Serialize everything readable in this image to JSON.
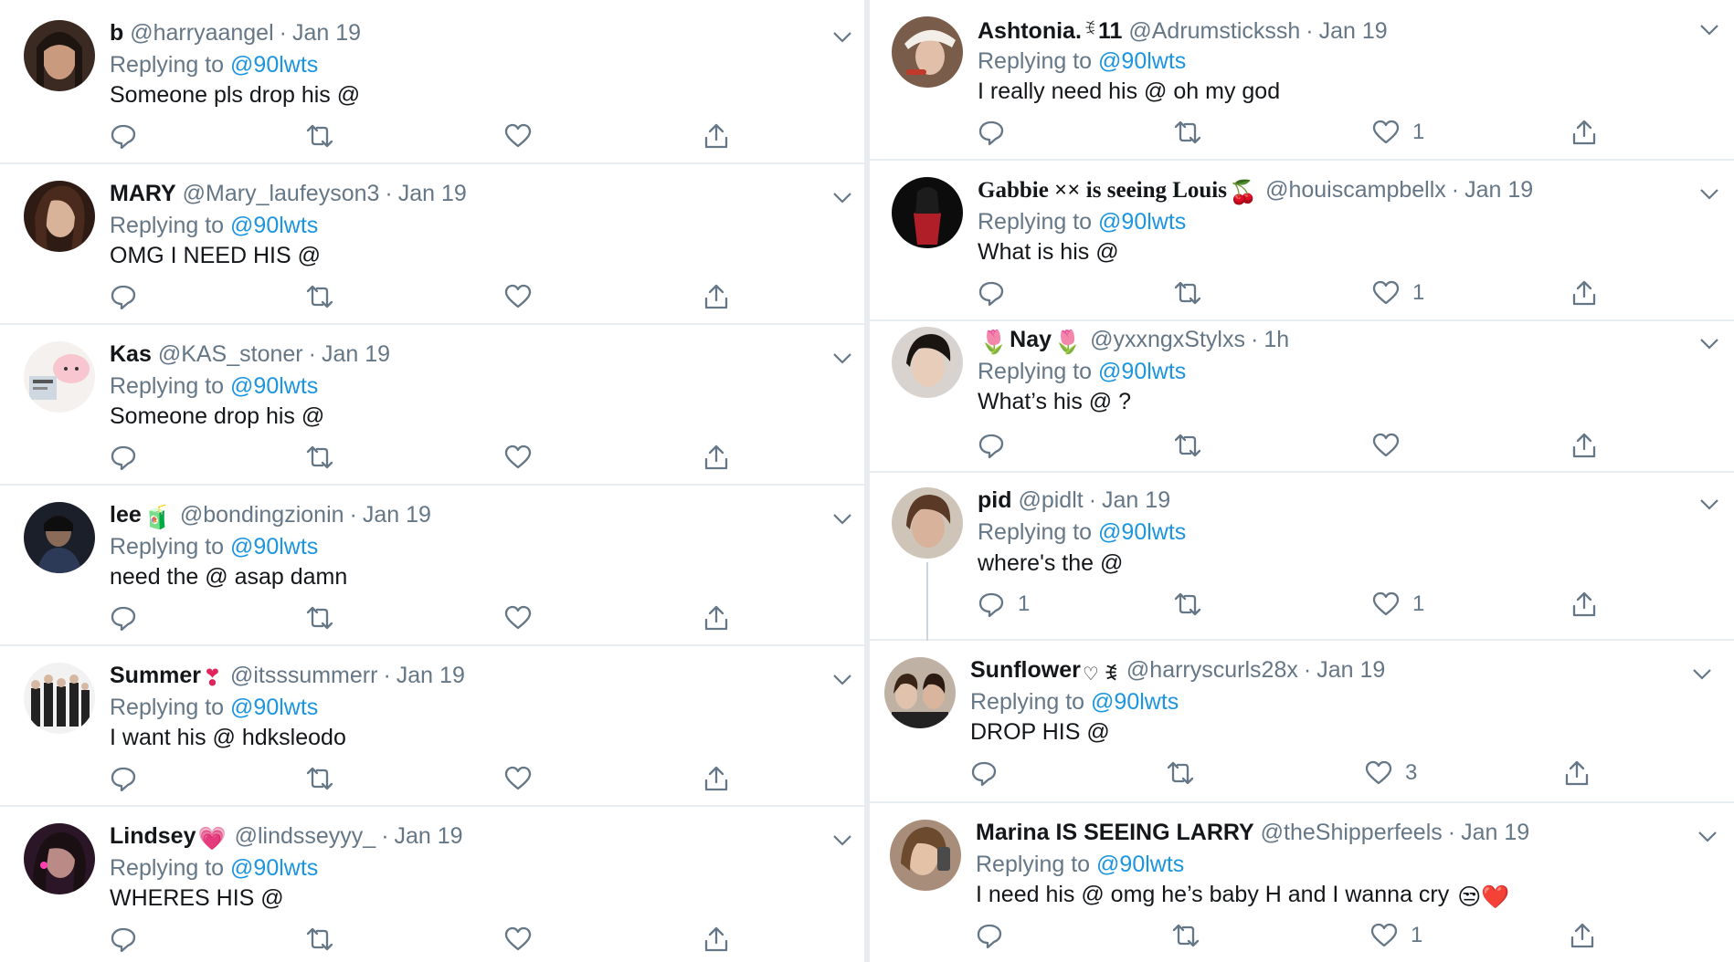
{
  "reply_prefix": "Replying to",
  "reply_target": "@90lwts",
  "left": [
    {
      "name": "b",
      "handle": "@harryaangel",
      "time": "Jan 19",
      "text": "Someone pls drop his @",
      "likes": "",
      "replies": ""
    },
    {
      "name": "MARY",
      "handle": "@Mary_laufeyson3",
      "time": "Jan 19",
      "text": "OMG I NEED HIS @",
      "likes": "",
      "replies": ""
    },
    {
      "name": "Kas",
      "handle": "@KAS_stoner",
      "time": "Jan 19",
      "text": "Someone drop his @",
      "likes": "",
      "replies": ""
    },
    {
      "name": "lee",
      "name_emoji": "🧃",
      "handle": "@bondingzionin",
      "time": "Jan 19",
      "text": "need the @ asap damn",
      "likes": "",
      "replies": ""
    },
    {
      "name": "Summer",
      "name_emoji": "❣",
      "handle": "@itsssummerr",
      "time": "Jan 19",
      "text": "I want his @ hdksleodo",
      "likes": "",
      "replies": ""
    },
    {
      "name": "Lindsey",
      "name_emoji": "💗",
      "handle": "@lindsseyyy_",
      "time": "Jan 19",
      "text": "WHERES HIS @",
      "likes": "",
      "replies": ""
    }
  ],
  "right": [
    {
      "name": "Ashtonia.",
      "name_emoji": "ꉂ",
      "name_suffix": "11",
      "handle": "@Adrumstickssh",
      "time": "Jan 19",
      "text": "I really need his  @ oh my god",
      "likes": "1",
      "replies": ""
    },
    {
      "name": "Gabbie ××  is seeing Louis",
      "name_emoji": "🍒",
      "handle": "@houiscampbellx",
      "time": "Jan 19",
      "text": "What is his @",
      "likes": "1",
      "replies": ""
    },
    {
      "name_prefix": "🌷",
      "name": "Nay",
      "name_emoji": "🌷",
      "handle": "@yxxngxStylxs",
      "time": "1h",
      "text": "What’s his @ ?",
      "likes": "",
      "replies": ""
    },
    {
      "name": "pid",
      "handle": "@pidlt",
      "time": "Jan 19",
      "text": "where's the @",
      "likes": "1",
      "replies": "1"
    },
    {
      "name": "Sunflower",
      "name_emoji": "♡ ꉂ",
      "handle": "@harryscurls28x",
      "time": "Jan 19",
      "text": "DROP HIS @",
      "likes": "3",
      "replies": ""
    },
    {
      "name": "Marina IS SEEING LARRY",
      "handle": "@theShipperfeels",
      "time": "Jan 19",
      "text": "I need his @ omg he’s baby H and I wanna cry",
      "text_emoji": "😒❤️",
      "likes": "1",
      "replies": ""
    }
  ],
  "colors": {
    "text": "#14171a",
    "muted": "#657786",
    "link": "#1b95e0",
    "divider": "#e6ecf0"
  }
}
